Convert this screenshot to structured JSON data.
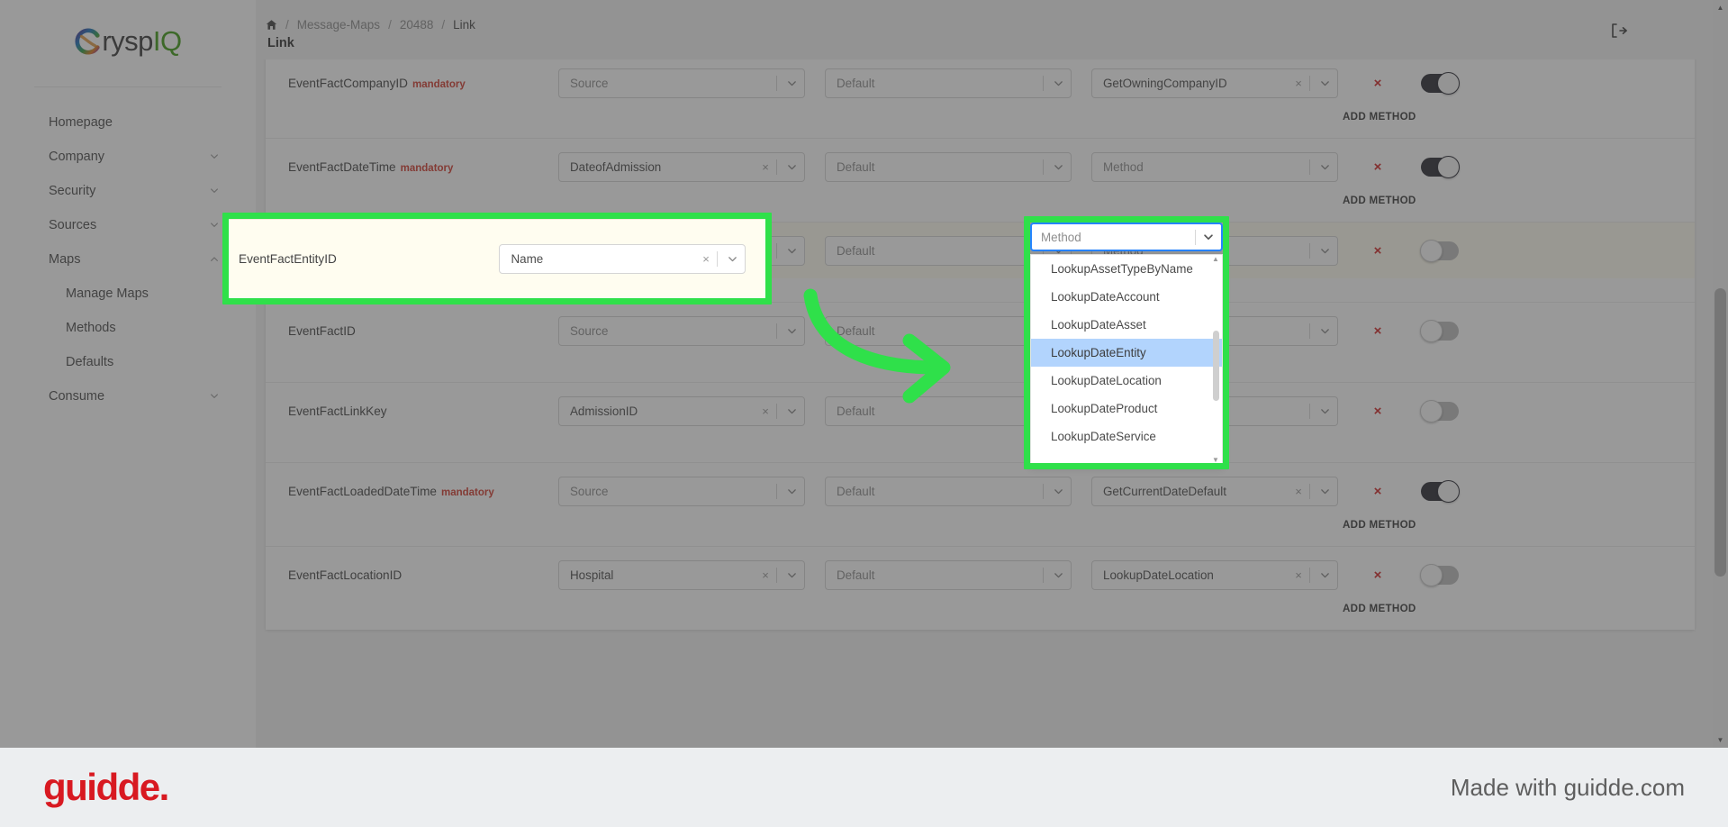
{
  "brand": {
    "c_letter": "C",
    "rysp": "rysp",
    "iq": "IQ",
    "full": "CryspIQ"
  },
  "sidebar": {
    "items": [
      {
        "label": "Homepage",
        "chevron": "",
        "sub": false
      },
      {
        "label": "Company",
        "chevron": "chevron-down-icon",
        "sub": false
      },
      {
        "label": "Security",
        "chevron": "chevron-down-icon",
        "sub": false
      },
      {
        "label": "Sources",
        "chevron": "chevron-down-icon",
        "sub": false
      },
      {
        "label": "Maps",
        "chevron": "chevron-up-icon",
        "sub": false
      },
      {
        "label": "Manage Maps",
        "chevron": "",
        "sub": true
      },
      {
        "label": "Methods",
        "chevron": "",
        "sub": true
      },
      {
        "label": "Defaults",
        "chevron": "",
        "sub": true
      },
      {
        "label": "Consume",
        "chevron": "chevron-down-icon",
        "sub": false
      }
    ]
  },
  "header": {
    "home_icon": "home-icon",
    "breadcrumb": [
      "Message-Maps",
      "20488",
      "Link"
    ],
    "separator": "/",
    "page_title": "Link",
    "logout_icon": "logout-icon"
  },
  "labels": {
    "add_method": "ADD METHOD",
    "delete_icon": "×",
    "clear_icon": "×",
    "mandatory": "mandatory"
  },
  "rows": [
    {
      "name": "",
      "mandatory": false,
      "partial": true,
      "source": "Source",
      "source_placeholder": true,
      "default": "Default",
      "default_placeholder": true,
      "method": "Method",
      "method_placeholder": true,
      "toggle_on": false,
      "add_method": false
    },
    {
      "name": "EventFactCompanyID",
      "mandatory": true,
      "source": "Source",
      "source_placeholder": true,
      "default": "Default",
      "default_placeholder": true,
      "method": "GetOwningCompanyID",
      "method_placeholder": false,
      "toggle_on": true,
      "add_method": true
    },
    {
      "name": "EventFactDateTime",
      "mandatory": true,
      "source": "DateofAdmission",
      "source_placeholder": false,
      "default": "Default",
      "default_placeholder": true,
      "method": "Method",
      "method_placeholder": true,
      "toggle_on": true,
      "add_method": true
    },
    {
      "name": "EventFactEntityID",
      "mandatory": false,
      "highlighted": true,
      "source": "Name",
      "source_placeholder": false,
      "default": "Default",
      "default_placeholder": true,
      "method": "Method",
      "method_placeholder": true,
      "toggle_on": false,
      "add_method": false
    },
    {
      "name": "EventFactID",
      "mandatory": false,
      "source": "Source",
      "source_placeholder": true,
      "default": "Default",
      "default_placeholder": true,
      "method": "",
      "method_placeholder": true,
      "toggle_on": false,
      "add_method": false
    },
    {
      "name": "EventFactLinkKey",
      "mandatory": false,
      "source": "AdmissionID",
      "source_placeholder": false,
      "default": "Default",
      "default_placeholder": true,
      "method": "",
      "method_placeholder": true,
      "toggle_on": false,
      "add_method": false
    },
    {
      "name": "EventFactLoadedDateTime",
      "mandatory": true,
      "source": "Source",
      "source_placeholder": true,
      "default": "Default",
      "default_placeholder": true,
      "method": "GetCurrentDateDefault",
      "method_placeholder": false,
      "toggle_on": true,
      "add_method": true
    },
    {
      "name": "EventFactLocationID",
      "mandatory": false,
      "source": "Hospital",
      "source_placeholder": false,
      "default": "Default",
      "default_placeholder": true,
      "method": "LookupDateLocation",
      "method_placeholder": false,
      "toggle_on": false,
      "add_method": true
    }
  ],
  "dropdown": {
    "placeholder": "Method",
    "open": true,
    "options": [
      "LookupAssetTypeByName",
      "LookupDateAccount",
      "LookupDateAsset",
      "LookupDateEntity",
      "LookupDateLocation",
      "LookupDateProduct",
      "LookupDateService"
    ],
    "selected": "LookupDateEntity"
  },
  "highlight_row": {
    "name": "EventFactEntityID",
    "source": "Name"
  },
  "footer": {
    "logo": "guidde.",
    "made_with": "Made with guidde.com"
  },
  "colors": {
    "callout_green": "#2fe04a",
    "brand_green": "#3f9c16",
    "danger_red": "#cf2222",
    "guidde_red": "#d81921",
    "dropdown_focus_blue": "#2684ff",
    "option_selected_blue": "#b2d4fd",
    "highlight_row_bg": "#fffdf0"
  }
}
